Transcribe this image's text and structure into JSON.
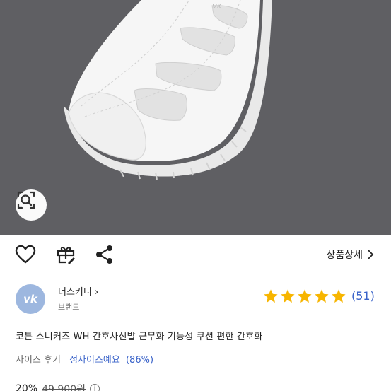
{
  "actions": {
    "detail_label": "상품상세"
  },
  "brand": {
    "logo_mark": "vk",
    "name": "너스키니",
    "type_label": "브랜드"
  },
  "rating": {
    "stars": 5,
    "review_count": "(51)"
  },
  "product": {
    "title": "코튼 스니커즈 WH 간호사신발 근무화 기능성 쿠션 편한 간호화"
  },
  "size_review": {
    "label": "사이즈 후기",
    "value": "정사이즈예요",
    "percent": "(86%)"
  },
  "price": {
    "discount": "20%",
    "original": "49,900원"
  },
  "colors": {
    "hero_bg": "#5f5f63",
    "accent_blue": "#3a63c9",
    "star": "#f7b500",
    "logo_bg": "#9db7df"
  },
  "icons": [
    "lens-search-icon",
    "heart-icon",
    "gift-icon",
    "share-icon",
    "chevron-right-icon",
    "star-icon",
    "info-icon"
  ]
}
